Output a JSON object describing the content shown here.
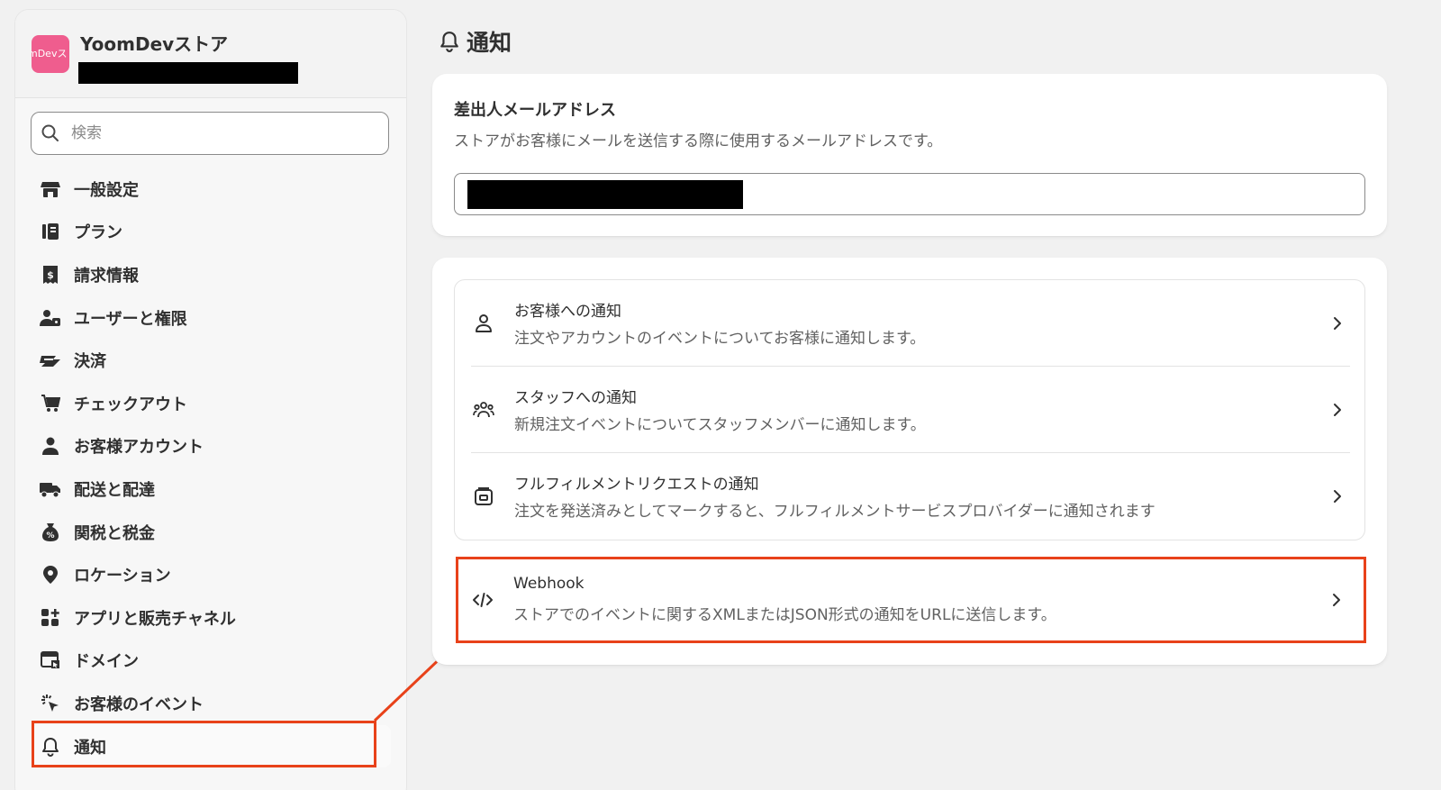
{
  "sidebar": {
    "store_name": "YoomDevストア",
    "store_logo_text": "mDevス",
    "search_placeholder": "検索",
    "items": [
      {
        "label": "一般設定",
        "icon": "store-icon"
      },
      {
        "label": "プラン",
        "icon": "plan-icon"
      },
      {
        "label": "請求情報",
        "icon": "receipt-icon"
      },
      {
        "label": "ユーザーと権限",
        "icon": "users-icon"
      },
      {
        "label": "決済",
        "icon": "payment-icon"
      },
      {
        "label": "チェックアウト",
        "icon": "cart-icon"
      },
      {
        "label": "お客様アカウント",
        "icon": "person-icon"
      },
      {
        "label": "配送と配達",
        "icon": "truck-icon"
      },
      {
        "label": "関税と税金",
        "icon": "tax-icon"
      },
      {
        "label": "ロケーション",
        "icon": "location-icon"
      },
      {
        "label": "アプリと販売チャネル",
        "icon": "apps-icon"
      },
      {
        "label": "ドメイン",
        "icon": "domain-icon"
      },
      {
        "label": "お客様のイベント",
        "icon": "cursor-click-icon"
      },
      {
        "label": "通知",
        "icon": "bell-icon"
      }
    ]
  },
  "main": {
    "title": "通知",
    "sender": {
      "title": "差出人メールアドレス",
      "description": "ストアがお客様にメールを送信する際に使用するメールアドレスです。"
    },
    "notifications": [
      {
        "title": "お客様への通知",
        "description": "注文やアカウントのイベントについてお客様に通知します。",
        "icon": "person-outline-icon"
      },
      {
        "title": "スタッフへの通知",
        "description": "新規注文イベントについてスタッフメンバーに通知します。",
        "icon": "team-icon"
      },
      {
        "title": "フルフィルメントリクエストの通知",
        "description": "注文を発送済みとしてマークすると、フルフィルメントサービスプロバイダーに通知されます",
        "icon": "package-icon"
      }
    ],
    "webhook": {
      "title": "Webhook",
      "description": "ストアでのイベントに関するXMLまたはJSON形式の通知をURLに送信します。",
      "icon": "code-icon"
    }
  },
  "colors": {
    "highlight": "#e8421a",
    "logo": "#ef5d8e"
  }
}
